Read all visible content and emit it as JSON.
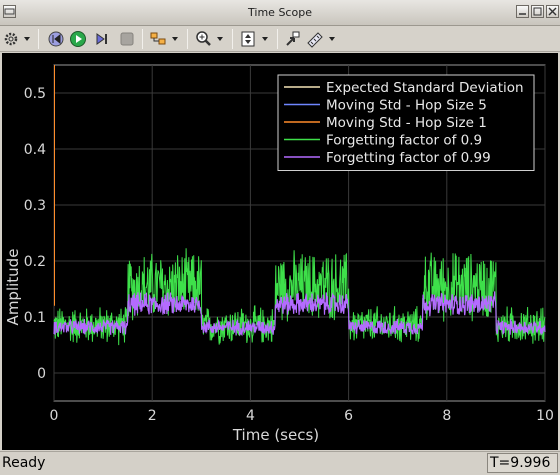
{
  "window": {
    "title": "Time Scope"
  },
  "toolbar": {
    "buttons": [
      {
        "name": "settings-icon"
      },
      {
        "name": "settings-menu-icon"
      },
      {
        "name": "step-back-icon"
      },
      {
        "name": "run-icon"
      },
      {
        "name": "step-forward-icon"
      },
      {
        "name": "stop-icon"
      },
      {
        "name": "highlight-blocks-icon"
      },
      {
        "name": "highlight-menu-icon"
      },
      {
        "name": "zoom-icon"
      },
      {
        "name": "zoom-menu-icon"
      },
      {
        "name": "autoscale-icon"
      },
      {
        "name": "autoscale-menu-icon"
      },
      {
        "name": "restore-icon"
      },
      {
        "name": "measure-icon"
      },
      {
        "name": "measure-menu-icon"
      }
    ]
  },
  "status": {
    "ready": "Ready",
    "time": "T=9.996"
  },
  "chart_data": {
    "type": "line",
    "xlabel": "Time (secs)",
    "ylabel": "Amplitude",
    "xlim": [
      0,
      10
    ],
    "ylim": [
      -0.05,
      0.55
    ],
    "xticks": [
      "0",
      "2",
      "4",
      "6",
      "8",
      "10"
    ],
    "yticks": [
      "0",
      "0.1",
      "0.2",
      "0.3",
      "0.4",
      "0.5"
    ],
    "grid": true,
    "legend_position": "top-right",
    "segments": [
      0,
      1.5,
      3,
      4.5,
      6,
      7.5,
      9,
      10
    ],
    "series": [
      {
        "name": "Expected Standard Deviation",
        "color": "#f5e6b8",
        "values": [
          0.1,
          0.1,
          0.1,
          0.1,
          0.1,
          0.1,
          0.1
        ]
      },
      {
        "name": "Moving Std - Hop Size 5",
        "color": "#6f86ff",
        "values": [
          0.1,
          0.1,
          0.1,
          0.1,
          0.1,
          0.1,
          0.1
        ]
      },
      {
        "name": "Moving Std - Hop Size 1",
        "color": "#ff8c2a",
        "values": [
          0.1,
          0.1,
          0.1,
          0.1,
          0.1,
          0.1,
          0.1
        ]
      },
      {
        "name": "Forgetting factor of 0.9",
        "color": "#3ee04a",
        "values": [
          0.085,
          0.155,
          0.085,
          0.155,
          0.085,
          0.155,
          0.085
        ]
      },
      {
        "name": "Forgetting factor of 0.99",
        "color": "#b46bff",
        "values": [
          0.082,
          0.123,
          0.082,
          0.123,
          0.082,
          0.123,
          0.082
        ]
      }
    ]
  }
}
